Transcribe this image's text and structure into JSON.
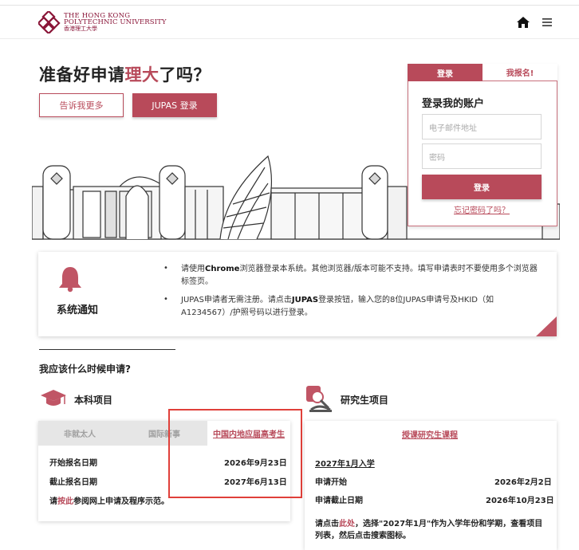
{
  "header": {
    "logo_line1": "THE HONG KONG",
    "logo_line2": "POLYTECHNIC UNIVERSITY",
    "logo_line3": "香港理工大學",
    "home_icon": "home-icon",
    "menu_icon": "hamburger-menu-icon"
  },
  "hero": {
    "title_prefix": "准备好申请",
    "title_highlight": "理大",
    "title_suffix": "了吗？",
    "tell_more_label": "告诉我更多",
    "jupas_login_label": "JUPAS 登录"
  },
  "login": {
    "tab_login": "登录",
    "tab_register": "我报名!",
    "heading": "登录我的账户",
    "email_placeholder": "电子邮件地址",
    "password_placeholder": "密码",
    "login_button": "登录",
    "forgot_password": "忘记密码了吗？"
  },
  "notice": {
    "title": "系统通知",
    "line1a": "请使用",
    "line1b": "Chrome",
    "line1c": "浏览器登录本系统。其他浏览器/版本可能不支持。填写申请表时不要使用多个浏览器",
    "line1d": "标签页。",
    "line2a": "JUPAS申请者无需注册。请点击",
    "line2b": "JUPAS",
    "line2c": "登录按钮，输入您的8位JUPAS申请号及HKID（如",
    "line2d": "A1234567）/护照号码以进行登录。",
    "bullet": "•"
  },
  "when": {
    "title": "我应该什么时候申请?",
    "undergrad_label": "本科项目",
    "postgrad_label": "研究生项目"
  },
  "undergrad": {
    "tabs": [
      "非就太人",
      "国际新事",
      "中国内地应届高考生"
    ],
    "rows": [
      {
        "label": "开始报名日期",
        "value": "2026年9月23日"
      },
      {
        "label": "截止报名日期",
        "value": "2027年6月13日"
      }
    ],
    "note_prefix": "请",
    "note_link": "按此",
    "note_suffix": "参阅网上申请及程序示范。"
  },
  "postgrad": {
    "tab": "授课研究生课程",
    "intake": "2027年1月入学",
    "rows": [
      {
        "label": "申请开始",
        "value": "2026年2月2日"
      },
      {
        "label": "申请截止日期",
        "value": "2026年10月23日"
      }
    ],
    "note_prefix": "请点击",
    "note_link": "此处",
    "note_suffix": "，选择\"2027年1月\"作为入学年份和学期，查看项目列表，然后点击搜索图标。"
  },
  "colors": {
    "brand": "#b84a5a",
    "highlight_box": "#e0403a"
  }
}
